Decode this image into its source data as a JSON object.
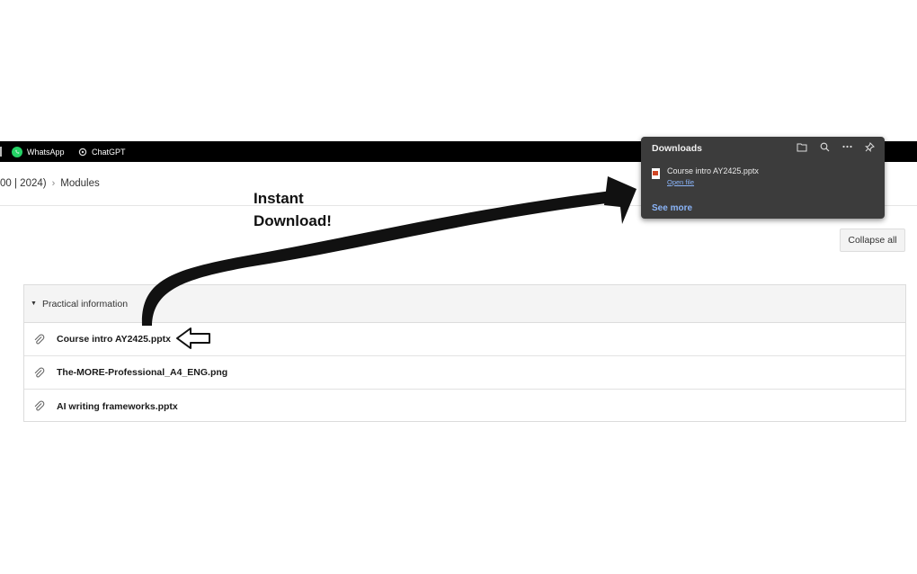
{
  "bookmarks": {
    "items": [
      {
        "label": "WhatsApp",
        "icon": "whatsapp-icon"
      },
      {
        "label": "ChatGPT",
        "icon": "chatgpt-icon"
      }
    ]
  },
  "breadcrumb": {
    "parent": "00 | 2024)",
    "current": "Modules"
  },
  "collapse_label": "Collapse all",
  "module": {
    "title": "Practical information",
    "files": [
      {
        "name": "Course intro AY2425.pptx"
      },
      {
        "name": "The-MORE-Professional_A4_ENG.png"
      },
      {
        "name": "AI writing frameworks.pptx"
      }
    ]
  },
  "annotation": {
    "line1": "Instant",
    "line2": "Download!"
  },
  "downloads_panel": {
    "title": "Downloads",
    "tools": [
      "folder-icon",
      "search-icon",
      "more-icon",
      "pin-icon"
    ],
    "item": {
      "filename": "Course intro AY2425.pptx",
      "action": "Open file"
    },
    "see_more": "See more"
  },
  "colors": {
    "bookmarks_bar": "#000000",
    "panel_bg": "#3c3c3c",
    "link": "#8ab4f8",
    "whatsapp": "#25d366"
  }
}
